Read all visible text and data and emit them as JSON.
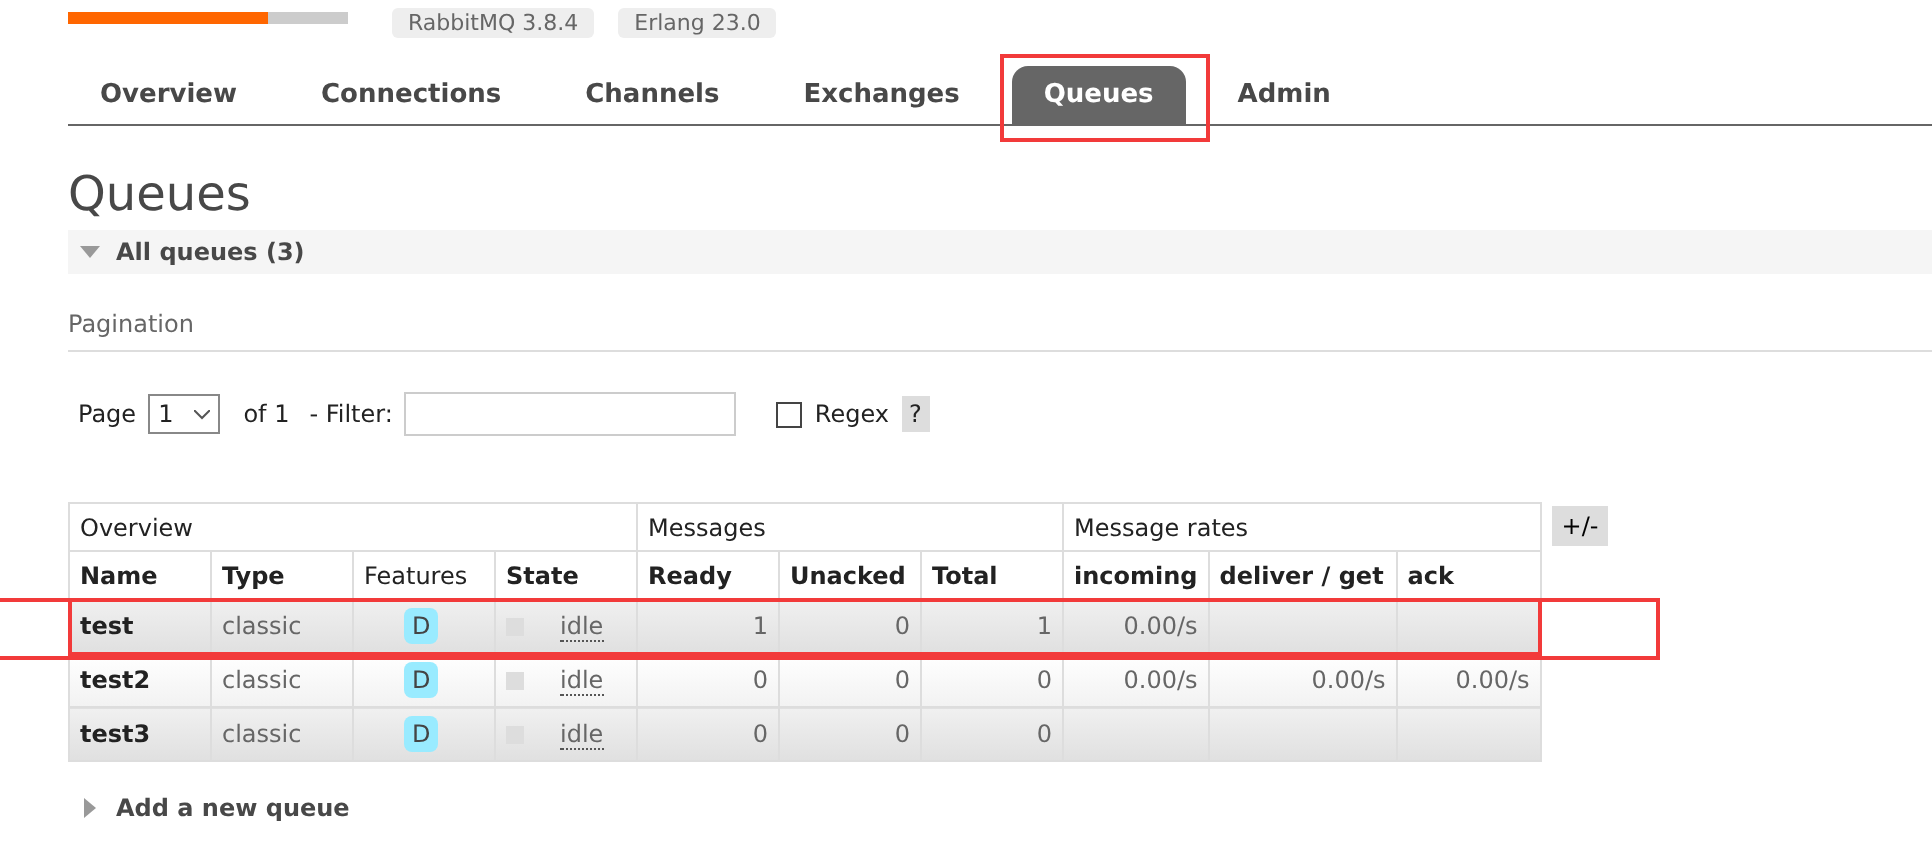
{
  "header": {
    "badges": [
      "RabbitMQ 3.8.4",
      "Erlang 23.0"
    ]
  },
  "tabs": [
    {
      "label": "Overview",
      "selected": false,
      "highlighted": false
    },
    {
      "label": "Connections",
      "selected": false,
      "highlighted": false
    },
    {
      "label": "Channels",
      "selected": false,
      "highlighted": false
    },
    {
      "label": "Exchanges",
      "selected": false,
      "highlighted": false
    },
    {
      "label": "Queues",
      "selected": true,
      "highlighted": true
    },
    {
      "label": "Admin",
      "selected": false,
      "highlighted": false
    }
  ],
  "page_title": "Queues",
  "section": {
    "label": "All queues (3)",
    "expanded": true
  },
  "pagination": {
    "heading": "Pagination",
    "page_label": "Page",
    "page_value": "1",
    "of_label": "of 1",
    "filter_label": "- Filter:",
    "regex_label": "Regex",
    "regex_checked": false,
    "help": "?"
  },
  "table": {
    "groups": [
      "Overview",
      "Messages",
      "Message rates"
    ],
    "columns": [
      "Name",
      "Type",
      "Features",
      "State",
      "Ready",
      "Unacked",
      "Total",
      "incoming",
      "deliver / get",
      "ack"
    ],
    "rows": [
      {
        "name": "test",
        "type": "classic",
        "feature": "D",
        "state": "idle",
        "ready": "1",
        "unacked": "0",
        "total": "1",
        "incoming": "0.00/s",
        "deliver_get": "",
        "ack": "",
        "highlighted": true
      },
      {
        "name": "test2",
        "type": "classic",
        "feature": "D",
        "state": "idle",
        "ready": "0",
        "unacked": "0",
        "total": "0",
        "incoming": "0.00/s",
        "deliver_get": "0.00/s",
        "ack": "0.00/s",
        "highlighted": false
      },
      {
        "name": "test3",
        "type": "classic",
        "feature": "D",
        "state": "idle",
        "ready": "0",
        "unacked": "0",
        "total": "0",
        "incoming": "",
        "deliver_get": "",
        "ack": "",
        "highlighted": false
      }
    ],
    "toggle": "+/-"
  },
  "add_section": {
    "label": "Add a new queue",
    "expanded": false
  }
}
